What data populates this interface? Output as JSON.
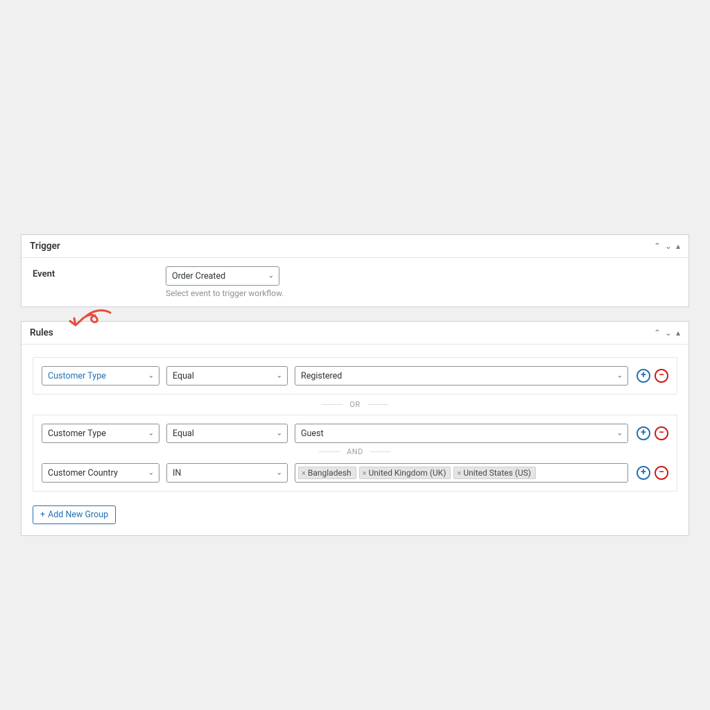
{
  "panels": {
    "trigger": {
      "title": "Trigger"
    },
    "rules": {
      "title": "Rules"
    }
  },
  "trigger": {
    "label": "Event",
    "selected": "Order Created",
    "help": "Select event to trigger workflow."
  },
  "rules": {
    "groups": [
      {
        "rows": [
          {
            "field": "Customer Type",
            "operator": "Equal",
            "value_type": "select",
            "value": "Registered"
          }
        ]
      },
      {
        "rows": [
          {
            "field": "Customer Type",
            "operator": "Equal",
            "value_type": "select",
            "value": "Guest"
          },
          {
            "field": "Customer Country",
            "operator": "IN",
            "value_type": "tags",
            "tags": [
              "Bangladesh",
              "United Kingdom (UK)",
              "United States (US)"
            ]
          }
        ]
      }
    ],
    "separators": {
      "or": "OR",
      "and": "AND"
    },
    "add_group_label": "Add New Group"
  },
  "icons": {
    "add": "+",
    "remove": "−",
    "chevron_down": "⌄",
    "chevron_up": "⌃",
    "triangle_up": "▴",
    "chip_close": "×"
  }
}
